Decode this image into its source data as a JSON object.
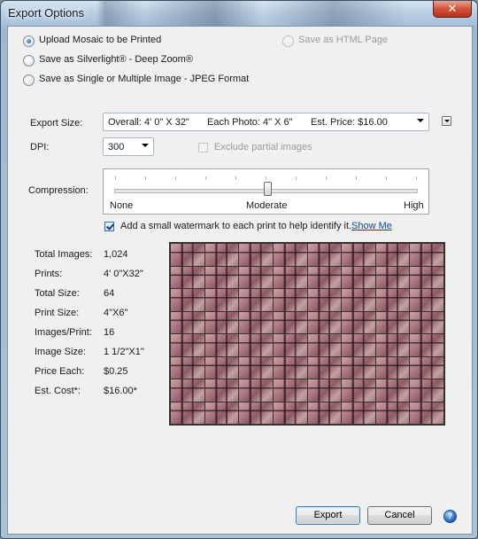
{
  "window": {
    "title": "Export Options",
    "close_glyph": "✕"
  },
  "export_targets": {
    "upload_mosaic": "Upload Mosaic to be Printed",
    "silverlight": "Save as Silverlight® - Deep Zoom®",
    "jpeg": "Save as Single or Multiple Image - JPEG Format",
    "html_page": "Save as HTML Page",
    "selected": "upload_mosaic"
  },
  "export_size": {
    "label": "Export Size:",
    "overall": "Overall: 4' 0\" X 32\"",
    "each_photo": "Each Photo: 4\" X 6\"",
    "est_price": "Est. Price: $16.00"
  },
  "dpi": {
    "label": "DPI:",
    "value": "300"
  },
  "exclude_partial": {
    "label": "Exclude partial images",
    "checked": false,
    "enabled": false
  },
  "compression": {
    "label": "Compression:",
    "min_label": "None",
    "mid_label": "Moderate",
    "max_label": "High",
    "level": 0.5
  },
  "watermark": {
    "label": "Add a small watermark to each print to help identify it.",
    "checked": true,
    "link": "Show Me"
  },
  "stats": [
    {
      "label": "Total Images:",
      "value": "1,024"
    },
    {
      "label": "Prints:",
      "value": "4' 0\"X32\""
    },
    {
      "label": "Total Size:",
      "value": "64"
    },
    {
      "label": "Print Size:",
      "value": "4\"X6\""
    },
    {
      "label": "Images/Print:",
      "value": "16"
    },
    {
      "label": "Image Size:",
      "value": "1 1/2\"X1\""
    },
    {
      "label": "Price Each:",
      "value": "$0.25"
    },
    {
      "label": "Est. Cost*:",
      "value": "$16.00*"
    }
  ],
  "mosaic_preview": {
    "columns": 8,
    "rows": 8
  },
  "buttons": {
    "export": "Export",
    "cancel": "Cancel",
    "help": "?"
  },
  "colors": {
    "accent": "#1550a8",
    "link": "#0645ad",
    "titlebar": "#b7cde2"
  },
  "icons": {
    "close": "close-icon",
    "help": "help-icon",
    "dropdown": "chevron-down-icon"
  }
}
